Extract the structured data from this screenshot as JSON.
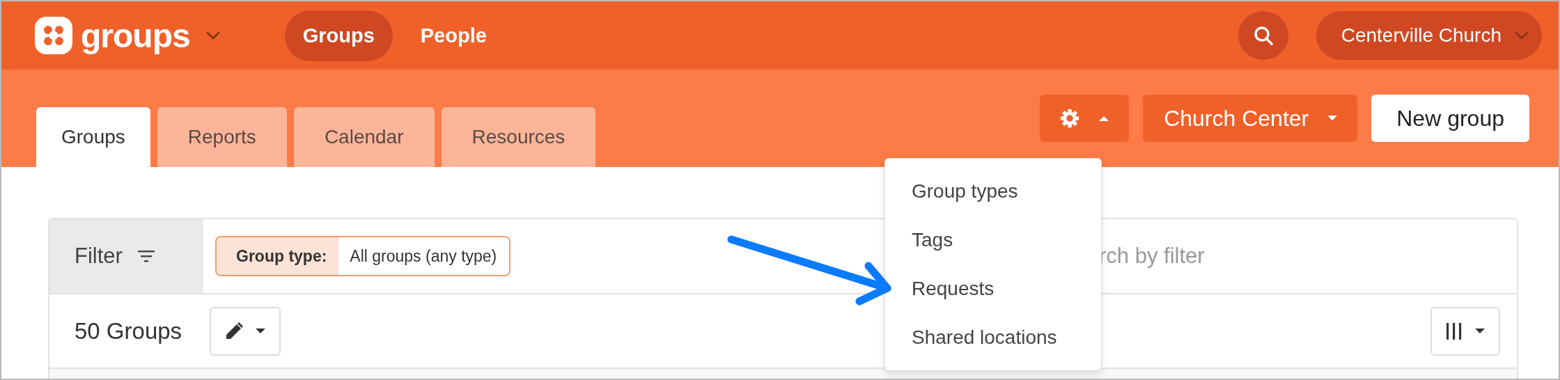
{
  "app": {
    "name": "groups"
  },
  "nav": [
    {
      "label": "Groups",
      "selected": true
    },
    {
      "label": "People",
      "selected": false
    }
  ],
  "organization": "Centerville Church",
  "tabs": [
    {
      "label": "Groups",
      "selected": true
    },
    {
      "label": "Reports",
      "selected": false
    },
    {
      "label": "Calendar",
      "selected": false
    },
    {
      "label": "Resources",
      "selected": false
    }
  ],
  "toolbar": {
    "settings_menu_expanded": true,
    "church_center": "Church Center",
    "new_group": "New group"
  },
  "settings_menu": {
    "items": [
      "Group types",
      "Tags",
      "Requests",
      "Shared locations"
    ]
  },
  "filter": {
    "label": "Filter",
    "chips": [
      {
        "name": "Group type:",
        "value": "All groups (any type)"
      }
    ],
    "search": {
      "placeholder": "rch by filter"
    }
  },
  "list": {
    "count": "50 Groups"
  }
}
